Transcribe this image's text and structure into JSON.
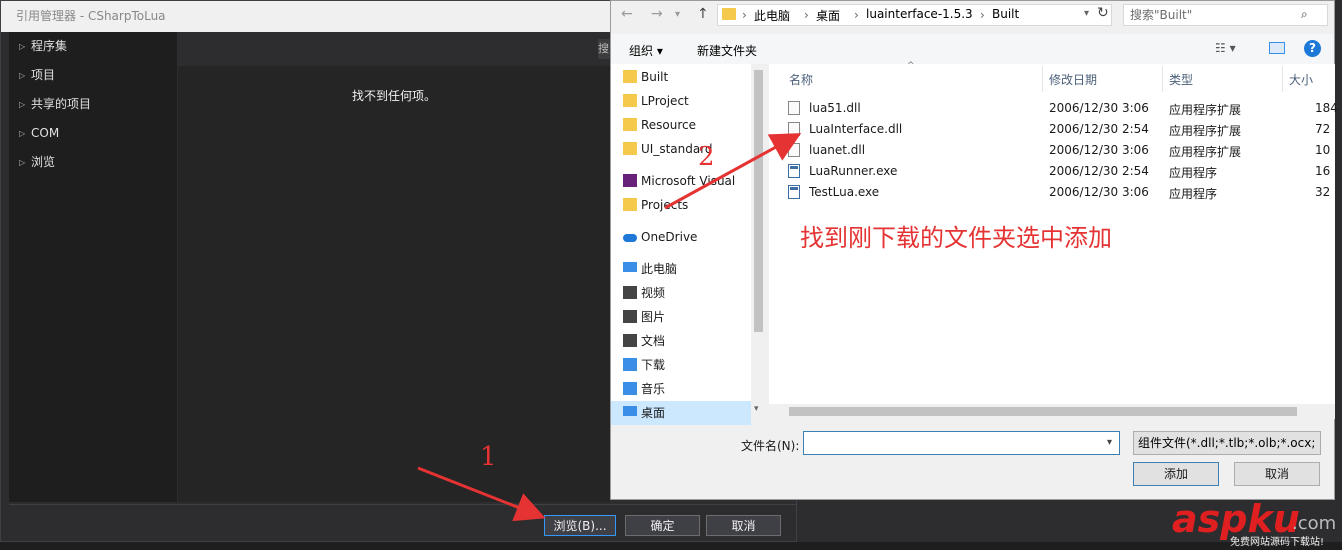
{
  "ref_manager": {
    "title": "引用管理器 - CSharpToLua",
    "tree": [
      "程序集",
      "项目",
      "共享的项目",
      "COM",
      "浏览"
    ],
    "empty_text": "找不到任何项。",
    "search_stub": "搜",
    "buttons": {
      "browse": "浏览(B)...",
      "ok": "确定",
      "cancel": "取消"
    }
  },
  "file_dialog": {
    "breadcrumb": [
      "此电脑",
      "桌面",
      "luainterface-1.5.3",
      "Built"
    ],
    "search_placeholder": "搜索\"Built\"",
    "toolbar": {
      "organize": "组织 ▾",
      "new_folder": "新建文件夹"
    },
    "nav_items": [
      {
        "label": "Built",
        "icon": "folder-icon",
        "color": "#f5c94c"
      },
      {
        "label": "LProject",
        "icon": "folder-error-icon",
        "color": "#f5c94c"
      },
      {
        "label": "Resource",
        "icon": "folder-icon",
        "color": "#f5c94c"
      },
      {
        "label": "UI_standard",
        "icon": "folder-check-icon",
        "color": "#f5c94c"
      },
      {
        "label": "Microsoft Visual",
        "icon": "visual-studio-icon",
        "color": "#68217a"
      },
      {
        "label": "Projects",
        "icon": "folder-icon",
        "color": "#f5c94c"
      },
      {
        "label": "OneDrive",
        "icon": "onedrive-icon",
        "color": "#1e78d7"
      },
      {
        "label": "此电脑",
        "icon": "computer-icon",
        "color": "#3a8ee6"
      },
      {
        "label": "视频",
        "icon": "video-icon",
        "color": "#444"
      },
      {
        "label": "图片",
        "icon": "pictures-icon",
        "color": "#444"
      },
      {
        "label": "文档",
        "icon": "documents-icon",
        "color": "#444"
      },
      {
        "label": "下载",
        "icon": "download-icon",
        "color": "#3a8ee6"
      },
      {
        "label": "音乐",
        "icon": "music-icon",
        "color": "#3a8ee6"
      },
      {
        "label": "桌面",
        "icon": "desktop-icon",
        "color": "#3a8ee6"
      }
    ],
    "columns": {
      "name": "名称",
      "date": "修改日期",
      "type": "类型",
      "size": "大小"
    },
    "files": [
      {
        "name": "lua51.dll",
        "date": "2006/12/30 3:06",
        "type": "应用程序扩展",
        "size": "184",
        "kind": "dll"
      },
      {
        "name": "LuaInterface.dll",
        "date": "2006/12/30 2:54",
        "type": "应用程序扩展",
        "size": "72",
        "kind": "dll"
      },
      {
        "name": "luanet.dll",
        "date": "2006/12/30 3:06",
        "type": "应用程序扩展",
        "size": "10",
        "kind": "dll"
      },
      {
        "name": "LuaRunner.exe",
        "date": "2006/12/30 2:54",
        "type": "应用程序",
        "size": "16",
        "kind": "exe"
      },
      {
        "name": "TestLua.exe",
        "date": "2006/12/30 3:06",
        "type": "应用程序",
        "size": "32",
        "kind": "exe"
      }
    ],
    "filename_label": "文件名(N):",
    "filename_value": "",
    "filter": "组件文件(*.dll;*.tlb;*.olb;*.ocx;",
    "buttons": {
      "add": "添加",
      "cancel": "取消"
    }
  },
  "annotations": {
    "step1": "1",
    "step2": "2",
    "instruction": "找到刚下载的文件夹选中添加"
  },
  "watermark": {
    "brand_a": "aspku",
    "brand_b": ".com",
    "tagline": "免费网站源码下载站!"
  },
  "colors": {
    "annotation": "#e53333",
    "accent": "#3c7fb1"
  }
}
